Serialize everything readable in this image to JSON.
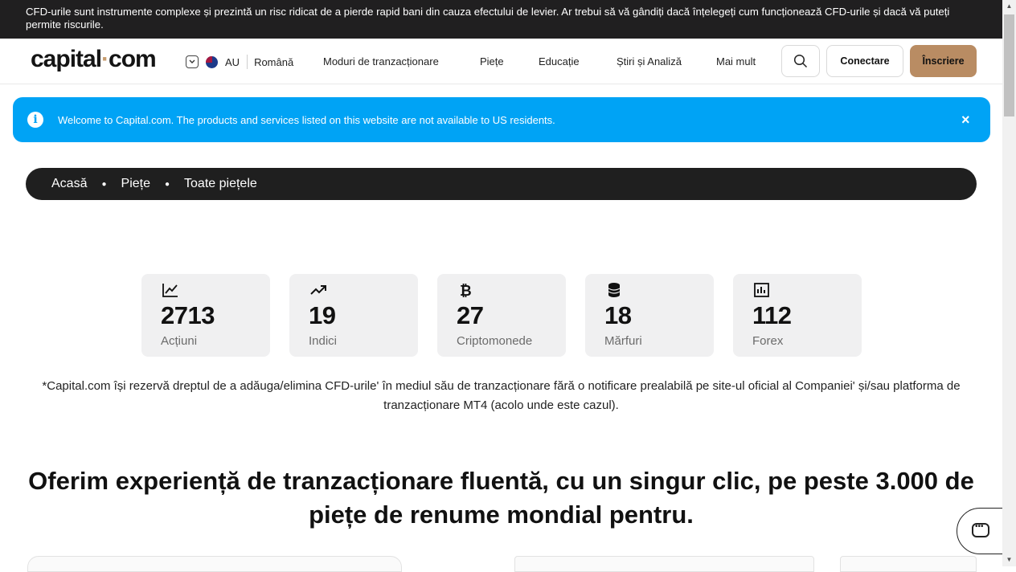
{
  "risk_banner": "CFD-urile sunt instrumente complexe și prezintă un risc ridicat de a pierde rapid bani din cauza efectului de levier. Ar trebui să vă gândiți dacă înțelegeți cum funcționează CFD-urile și dacă vă puteți permite riscurile.",
  "header": {
    "logo_left": "capital",
    "logo_dot": "·",
    "logo_right": "com",
    "region": "AU",
    "language": "Română",
    "nav": [
      "Moduri de tranzacționare",
      "Piețe",
      "Educație",
      "Știri și Analiză",
      "Mai mult"
    ],
    "login": "Conectare",
    "signup": "Înscriere"
  },
  "notice": {
    "text": "Welcome to Capital.com. The products and services listed on this website are not available to US residents.",
    "close": "×",
    "color": "#00a3f5"
  },
  "breadcrumb": [
    "Acasă",
    "Piețe",
    "Toate piețele"
  ],
  "stats": [
    {
      "icon": "line-chart-icon",
      "value": "2713",
      "label": "Acțiuni"
    },
    {
      "icon": "trending-up-icon",
      "value": "19",
      "label": "Indici"
    },
    {
      "icon": "bitcoin-icon",
      "value": "27",
      "label": "Criptomonede"
    },
    {
      "icon": "coins-stack-icon",
      "value": "18",
      "label": "Mărfuri"
    },
    {
      "icon": "bar-chart-icon",
      "value": "112",
      "label": "Forex"
    }
  ],
  "disclaimer": "*Capital.com își rezervă dreptul de a adăuga/elimina CFD-urile' în mediul său de tranzacționare fără o notificare prealabilă pe site-ul oficial al Companiei' și/sau platforma de tranzacționare MT4 (acolo unde este cazul).",
  "headline": "Oferim experiență de tranzacționare fluentă, cu un singur clic, pe peste 3.000 de piețe de renume mondial pentru.",
  "colors": {
    "brand_gold": "#b98c63",
    "dark": "#201f20"
  }
}
